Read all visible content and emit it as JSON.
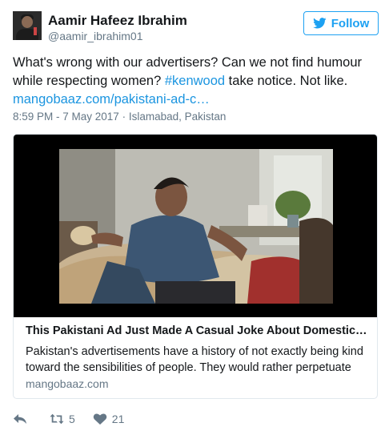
{
  "user": {
    "name": "Aamir Hafeez Ibrahim",
    "handle": "@aamir_ibrahim01"
  },
  "follow_button": {
    "label": "Follow"
  },
  "tweet": {
    "text_before": "What's wrong with our advertisers? Can we not find humour while respecting women? ",
    "hashtag": "#kenwood",
    "text_after": " take notice. Not like.",
    "link": "mangobaaz.com/pakistani-ad-c…"
  },
  "meta": {
    "time_place": "8:59 PM - 7 May 2017 · Islamabad, Pakistan"
  },
  "card": {
    "title": "This Pakistani Ad Just Made A Casual Joke About Domestic …",
    "description": "Pakistan's advertisements have a history of not exactly being kind toward the sensibilities of people. They would rather perpetuate",
    "domain": "mangobaaz.com"
  },
  "actions": {
    "reply": "",
    "retweets": "5",
    "likes": "21"
  },
  "colors": {
    "twitter_blue": "#1da1f2",
    "link": "#1b95e0",
    "secondary_text": "#657786",
    "border": "#e1e8ed"
  },
  "icons": [
    "twitter-bird-icon",
    "reply-icon",
    "retweet-icon",
    "heart-icon"
  ]
}
